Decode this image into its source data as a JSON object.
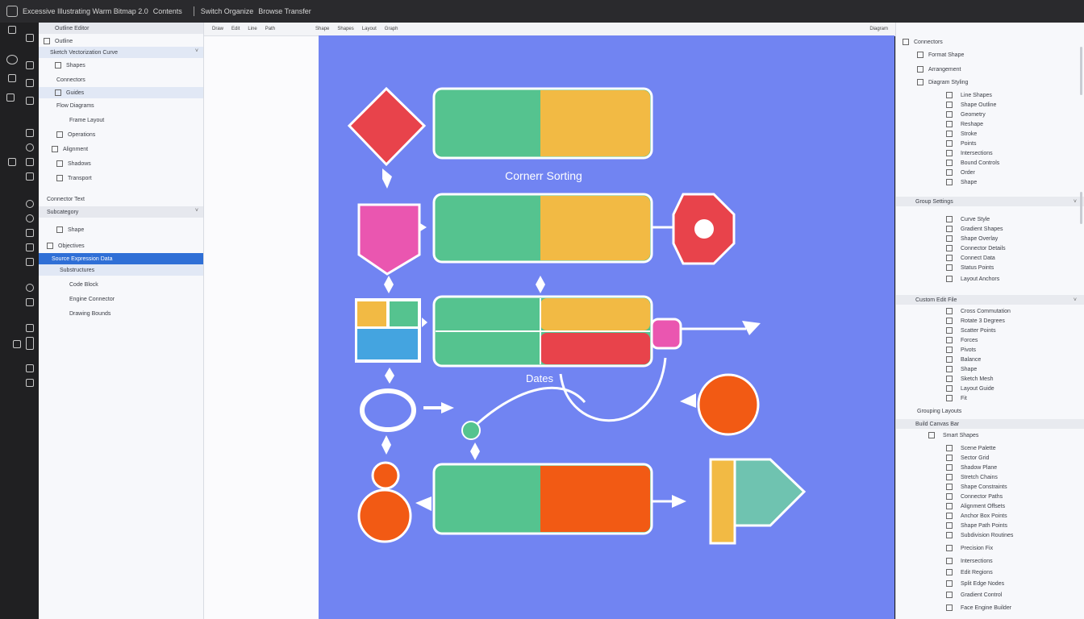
{
  "window": {
    "title": "Excessive Illustrating Warm Bitmap 2.0",
    "menu_a": "Contents",
    "menu_b": "Switch Organize",
    "menu_c": "Browse Transfer"
  },
  "canvas_tabs": [
    "Draw",
    "Edit",
    "Line",
    "Path",
    "Shape",
    "Shapes",
    "Layout",
    "Graph"
  ],
  "canvas_zoom": "Diagram",
  "left_panel": {
    "header": "Outline Editor",
    "items": [
      "Outline",
      "Sketch Vectorization Curve",
      "Shapes",
      "Connectors",
      "Guides",
      "Flow Diagrams",
      "Frame Layout",
      "Operations",
      "Alignment",
      "Shadows",
      "Transport",
      "Connector Text",
      "Subcategory",
      "Shape",
      "Objectives",
      "Source Expression Data",
      "Substructures",
      "Code Block",
      "Engine Connector",
      "Drawing Bounds"
    ]
  },
  "right_panel": {
    "header": "Connectors",
    "items_top": [
      "Format Shape",
      "Arrangement",
      "Diagram Styling"
    ],
    "group1": [
      "Line Shapes",
      "Shape Outline",
      "Geometry",
      "Reshape",
      "Stroke",
      "Points",
      "Intersections",
      "Bound Controls",
      "Order",
      "Shape"
    ],
    "section2": "Group Settings",
    "group2": [
      "Curve Style",
      "Gradient Shapes",
      "Shape Overlay",
      "Connector Details",
      "Connect Data",
      "Status Points",
      "Layout Anchors"
    ],
    "section3": "Custom Edit File",
    "group3": [
      "Cross Commutation",
      "Rotate 3 Degrees",
      "Scatter Points",
      "Forces",
      "Pivots",
      "Balance",
      "Shape",
      "Sketch Mesh",
      "Layout Guide",
      "Fit"
    ],
    "section4": "Grouping Layouts",
    "section5": "Build Canvas Bar",
    "group5_head": "Smart Shapes",
    "group5": [
      "Scene Palette",
      "Sector Grid",
      "Shadow Plane",
      "Stretch Chains",
      "Shape Constraints",
      "Connector Paths",
      "Alignment Offsets",
      "Anchor Box Points",
      "Shape Path Points",
      "Subdivision Routines",
      "Precision Fix",
      "Intersections",
      "Edit Regions",
      "Split Edge Nodes",
      "Gradient Control",
      "Face Engine Builder"
    ]
  },
  "diagram": {
    "label_top": "Cornerr Sorting",
    "label_mid": "Dates"
  },
  "colors": {
    "canvas_bg": "#7184f2",
    "green": "#55c38f",
    "yellow": "#f2ba44",
    "red": "#e8434b",
    "pink": "#ea56b0",
    "blue": "#44a4e0",
    "orange": "#f25a14",
    "teal": "#6fc3b0",
    "selection": "#2f6fd6"
  }
}
